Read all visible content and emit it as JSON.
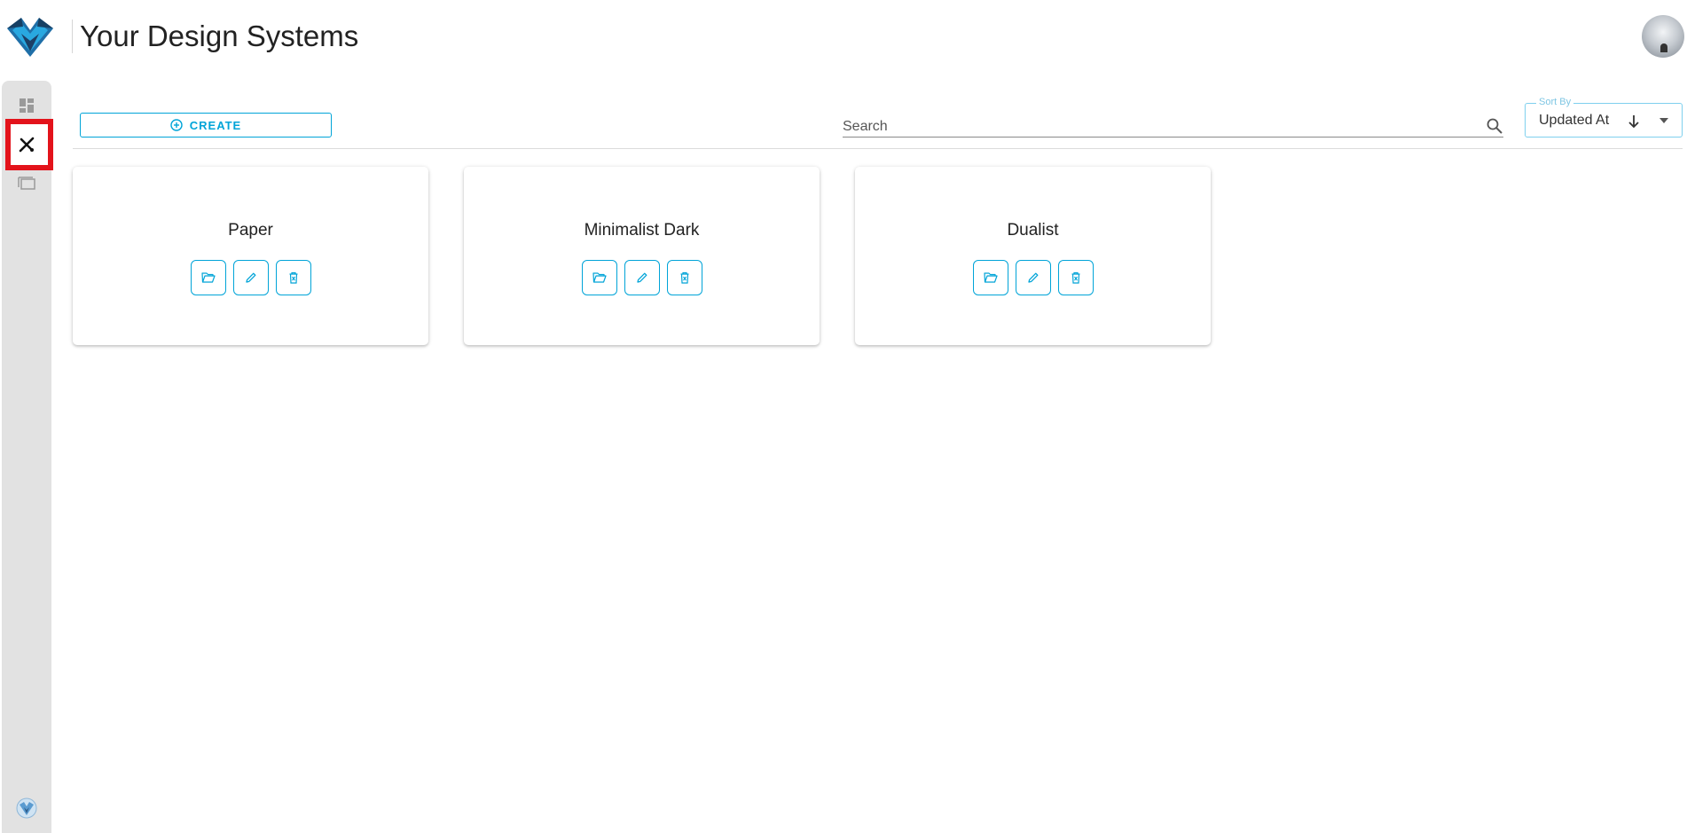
{
  "header": {
    "title": "Your Design Systems",
    "logo_icon": "fox-logo-icon",
    "avatar_icon": "user-avatar"
  },
  "sidebar": {
    "items": [
      {
        "icon": "dashboard-icon",
        "selected": false
      },
      {
        "icon": "design-tools-icon",
        "selected": true
      },
      {
        "icon": "projects-icon",
        "selected": false
      }
    ],
    "bottom_icon": "fox-badge-icon"
  },
  "toolbar": {
    "create_label": "CREATE",
    "search_placeholder": "Search",
    "sort": {
      "label": "Sort By",
      "value": "Updated At",
      "direction": "descending"
    }
  },
  "cards": [
    {
      "title": "Paper"
    },
    {
      "title": "Minimalist Dark"
    },
    {
      "title": "Dualist"
    }
  ],
  "colors": {
    "accent": "#00a4d8",
    "selection_highlight": "#e3131b",
    "sidebar_bg": "#e2e2e2"
  }
}
